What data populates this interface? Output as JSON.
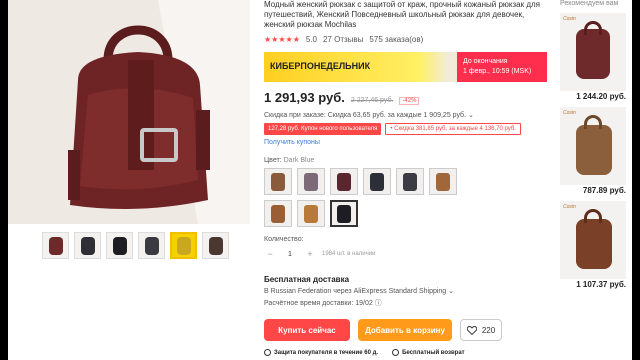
{
  "product": {
    "title": "Модный женский рюкзак с защитой от краж, прочный кожаный рюкзак для путешествий, Женский Повседневный школьный рюкзак для девочек, женский рюкзак Mochilas",
    "rating": "5.0",
    "stars": "★★★★★",
    "reviews": "27 Отзывы",
    "orders": "575 заказа(ов)"
  },
  "banner": {
    "label": "КИБЕРПОНЕДЕЛЬНИК",
    "timer_line1": "До окончания",
    "timer_line2": "1 февр., 10:59 (MSK)"
  },
  "price": {
    "current": "1 291,93 руб.",
    "old": "2 227,46 руб.",
    "discount": "-42%"
  },
  "discount_line": "Скидка при заказе: Скидка 63,65 руб. за каждые 1 909,25 руб. ⌄",
  "coupons": [
    "127,28 руб. Купон нового пользователя",
    "• Скидка 381,85 руб. за каждые 4 136,70 руб."
  ],
  "get_coupons": "Получить купоны",
  "color": {
    "label": "Цвет:",
    "value": "Dark Blue",
    "swatch_colors": [
      "#8a5a3c",
      "#7d6a78",
      "#5a2630",
      "#2c2e38",
      "#3b3c44",
      "#a0683a",
      "#9a5e34",
      "#b87a3a",
      "#1e1e22"
    ]
  },
  "quantity": {
    "label": "Количество:",
    "minus": "−",
    "value": "1",
    "plus": "+",
    "stock": "1984 шт. в наличии"
  },
  "shipping": {
    "title": "Бесплатная доставка",
    "route": "В Russian Federation через AliExpress Standard Shipping ⌄",
    "estimate": "Расчётное время доставки: 19/02 ⓘ"
  },
  "actions": {
    "buy": "Купить сейчас",
    "cart": "Добавить в корзину",
    "wishlist_count": "220"
  },
  "guarantees": [
    "Защита покупателя в течение 60 д.",
    "Бесплатный возврат"
  ],
  "recommendations": {
    "title": "Рекомендуем вам",
    "items": [
      {
        "brand": "Cosin",
        "price": "1 244.20 руб.",
        "color": "#6e2a2a"
      },
      {
        "brand": "Cosin",
        "price": "787.89 руб.",
        "color": "#8b5e3c"
      },
      {
        "brand": "Cosin",
        "price": "1 107.37 руб.",
        "color": "#7a4028"
      }
    ]
  },
  "thumbnails": {
    "colors": [
      "#6e2a2a",
      "#2e2e34",
      "#1e1e22",
      "#3a3a40",
      "#c9a820",
      "#4a3830"
    ]
  }
}
